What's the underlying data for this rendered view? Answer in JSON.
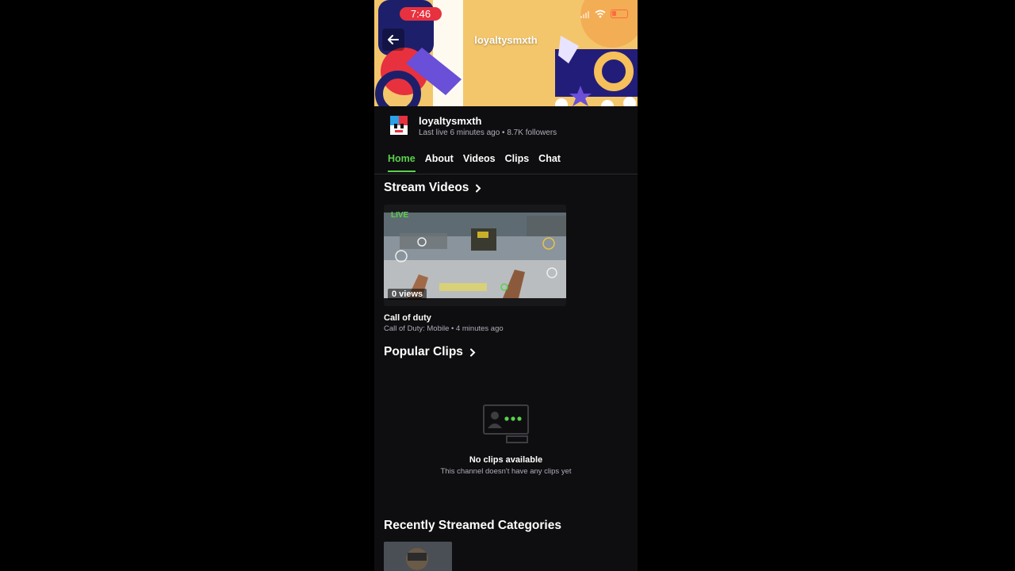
{
  "status_bar": {
    "time": "7:46"
  },
  "banner": {
    "title": "loyaltysmxth"
  },
  "channel": {
    "name": "loyaltysmxth",
    "meta": "Last live 6 minutes ago • 8.7K followers"
  },
  "tabs": [
    {
      "label": "Home",
      "active": true
    },
    {
      "label": "About",
      "active": false
    },
    {
      "label": "Videos",
      "active": false
    },
    {
      "label": "Clips",
      "active": false
    },
    {
      "label": "Chat",
      "active": false
    }
  ],
  "stream_videos": {
    "heading": "Stream Videos",
    "video": {
      "live_label": "LIVE",
      "views": "0 views",
      "title": "Call of duty",
      "meta": "Call of Duty: Mobile • 4 minutes ago"
    }
  },
  "popular_clips": {
    "heading": "Popular Clips",
    "empty_title": "No clips available",
    "empty_subtitle": "This channel doesn't have any clips yet"
  },
  "recent_categories": {
    "heading": "Recently Streamed Categories"
  },
  "colors": {
    "accent": "#5ad14b",
    "background": "#0e0e10",
    "banner": "#f4c66b",
    "status_pill": "#e8313e"
  },
  "icons": [
    "back-arrow-icon",
    "wifi-icon",
    "signal-icon",
    "battery-icon",
    "chevron-right-icon",
    "no-clips-icon"
  ]
}
